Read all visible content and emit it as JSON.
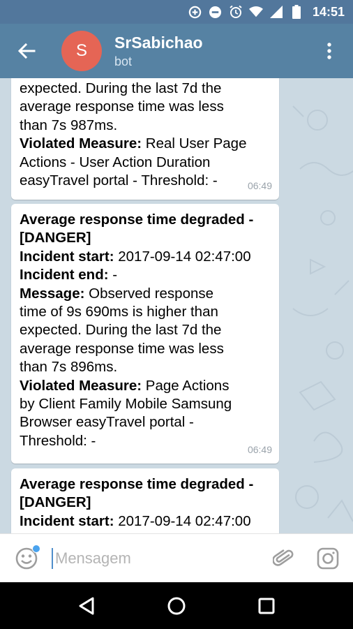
{
  "status_bar": {
    "time": "14:51",
    "icons": [
      "data-saver-icon",
      "do-not-disturb-icon",
      "alarm-icon",
      "wifi-icon",
      "signal-icon",
      "battery-icon"
    ]
  },
  "header": {
    "title": "SrSabichao",
    "subtitle": "bot",
    "avatar_letter": "S",
    "avatar_color": "#e56555",
    "bar_color": "#5682a3"
  },
  "messages": [
    {
      "lines": [
        {
          "bold": "",
          "text": "expected. During the last 7d the"
        },
        {
          "bold": "",
          "text": "average response time was less"
        },
        {
          "bold": "",
          "text": "than 7s 987ms."
        },
        {
          "bold": "Violated Measure:",
          "text": " Real User Page"
        },
        {
          "bold": "",
          "text": "Actions - User Action Duration"
        },
        {
          "bold": "",
          "text": "easyTravel portal - Threshold: -"
        }
      ],
      "time": "06:49"
    },
    {
      "lines": [
        {
          "bold": "Average response time degraded -",
          "text": ""
        },
        {
          "bold": "[DANGER]",
          "text": ""
        },
        {
          "bold": "Incident start:",
          "text": " 2017-09-14 02:47:00"
        },
        {
          "bold": "Incident end:",
          "text": " -"
        },
        {
          "bold": "Message:",
          "text": " Observed response"
        },
        {
          "bold": "",
          "text": "time of 9s 690ms is higher than"
        },
        {
          "bold": "",
          "text": "expected. During the last 7d the"
        },
        {
          "bold": "",
          "text": "average response time was less"
        },
        {
          "bold": "",
          "text": "than 7s 896ms."
        },
        {
          "bold": "Violated Measure:",
          "text": " Page Actions"
        },
        {
          "bold": "",
          "text": "by Client Family Mobile Samsung"
        },
        {
          "bold": "",
          "text": "Browser easyTravel portal -"
        },
        {
          "bold": "",
          "text": "Threshold: -"
        }
      ],
      "time": "06:49"
    },
    {
      "lines": [
        {
          "bold": "Average response time degraded -",
          "text": ""
        },
        {
          "bold": "[DANGER]",
          "text": ""
        },
        {
          "bold": "Incident start:",
          "text": " 2017-09-14 02:47:00"
        }
      ],
      "time": ""
    }
  ],
  "input": {
    "placeholder": "Mensagem"
  },
  "nav": {
    "buttons": [
      "back-triangle-icon",
      "home-circle-icon",
      "recents-square-icon"
    ]
  }
}
